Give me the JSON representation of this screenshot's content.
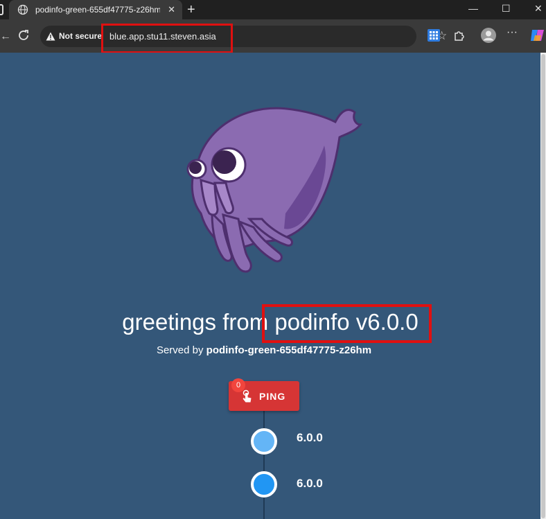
{
  "browser": {
    "tab_title": "podinfo-green-655df47775-z26hm",
    "not_secure_label": "Not secure",
    "url": "blue.app.stu11.steven.asia"
  },
  "page": {
    "greeting": "greetings from podinfo v6.0.0",
    "served_prefix": "Served by",
    "served_host": "podinfo-green-655df47775-z26hm",
    "ping_label": "PING",
    "ping_count": "0",
    "timeline": [
      {
        "version": "6.0.0",
        "color": "#64b5f6"
      },
      {
        "version": "6.0.0",
        "color": "#2196f3"
      }
    ]
  },
  "colors": {
    "background": "#345779",
    "ping_button": "#d63535",
    "highlight_box": "#e01010"
  }
}
